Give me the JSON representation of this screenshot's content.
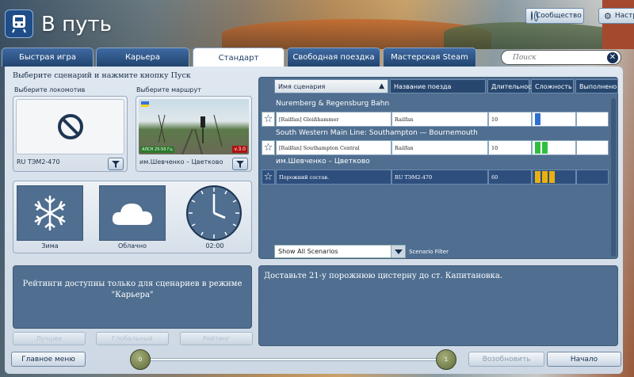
{
  "header": {
    "title": "В путь",
    "community_label": "Сообщество",
    "settings_label": "Настр"
  },
  "tabs": [
    {
      "label": "Быстрая игра"
    },
    {
      "label": "Карьера"
    },
    {
      "label": "Стандарт"
    },
    {
      "label": "Свободная поездка"
    },
    {
      "label": "Мастерская Steam"
    }
  ],
  "search": {
    "placeholder": "Поиск"
  },
  "left": {
    "instruction": "Выберите сценарий и нажмите кнопку Пуск",
    "loco_label": "Выберите локомотив",
    "route_label": "Выберите маршрут",
    "loco_name": "RU ТЭМ2-470",
    "route_name": "им.Шевченко – Цветково",
    "route_badge_left": "АЛСН 25-50 Гц",
    "route_badge_right": "v.3.0",
    "weather": {
      "season": "Зима",
      "sky": "Облачно",
      "time": "02:00"
    },
    "ratings_text": "Рейтинги доступны только для сценариев в режиме \"Карьера\"",
    "buttons": [
      "Лучшее",
      "Глобальный",
      "Рейтинг"
    ]
  },
  "table": {
    "columns": [
      "Имя сценария",
      "Название поезда",
      "Длительнос",
      "Сложность",
      "Выполнено"
    ],
    "groups": [
      {
        "name": "Nuremberg & Regensburg Bahn",
        "rows": [
          {
            "name": "[Railfan] Gleißhammer",
            "train": "Railfan",
            "duration": "10"
          }
        ]
      },
      {
        "name": "South Western Main Line: Southampton — Bournemouth",
        "rows": [
          {
            "name": "[Railfan] Southampton Central",
            "train": "Railfan",
            "duration": "10"
          }
        ]
      },
      {
        "name": "им.Шевченко – Цветково",
        "rows": [
          {
            "name": "Порожний состав.",
            "train": "RU ТЭМ2-470",
            "duration": "60"
          }
        ]
      }
    ],
    "difficulty": [
      1,
      2,
      3
    ],
    "filter_value": "Show All Scenarios",
    "filter_label": "Scenario Filter"
  },
  "description": "Доставьте 21-у порожнюю цистерну до ст. Капитановка.",
  "footer": {
    "main_menu": "Главное меню",
    "slider_min": "0",
    "slider_max": "1",
    "resume": "Возобновить",
    "start": "Начало"
  },
  "colors": {
    "panel": "#4f6e90",
    "accent": "#27476f",
    "easy": "#2f6fd0",
    "medium": "#2fbf3f",
    "hard": "#e8b010"
  }
}
